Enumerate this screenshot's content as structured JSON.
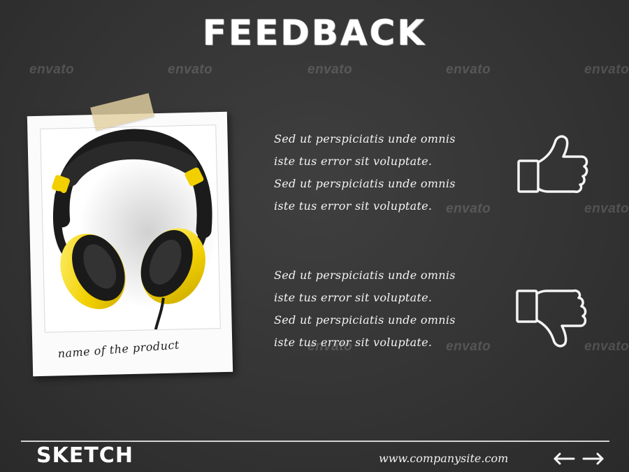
{
  "header": {
    "title": "FEEDBACK"
  },
  "watermark": {
    "text": "envato"
  },
  "product": {
    "caption": "name of the product",
    "image_icon": "headphones-image"
  },
  "feedback": {
    "positive": {
      "icon": "thumbs-up-icon",
      "lines": [
        "Sed ut perspiciatis unde omnis",
        "iste tus error sit voluptate.",
        "Sed ut perspiciatis unde omnis",
        "iste tus error sit voluptate."
      ]
    },
    "negative": {
      "icon": "thumbs-down-icon",
      "lines": [
        "Sed ut perspiciatis unde omnis",
        "iste tus error sit voluptate.",
        "Sed ut perspiciatis unde omnis",
        "iste tus error sit voluptate."
      ]
    }
  },
  "footer": {
    "brand": "SKETCH",
    "website": "www.companysite.com",
    "prev_icon": "arrow-left-icon",
    "next_icon": "arrow-right-icon"
  },
  "colors": {
    "board": "#353535",
    "chalk": "#f2f2f2",
    "headphone_yellow": "#f2d000",
    "tape": "#e2d0a0"
  }
}
